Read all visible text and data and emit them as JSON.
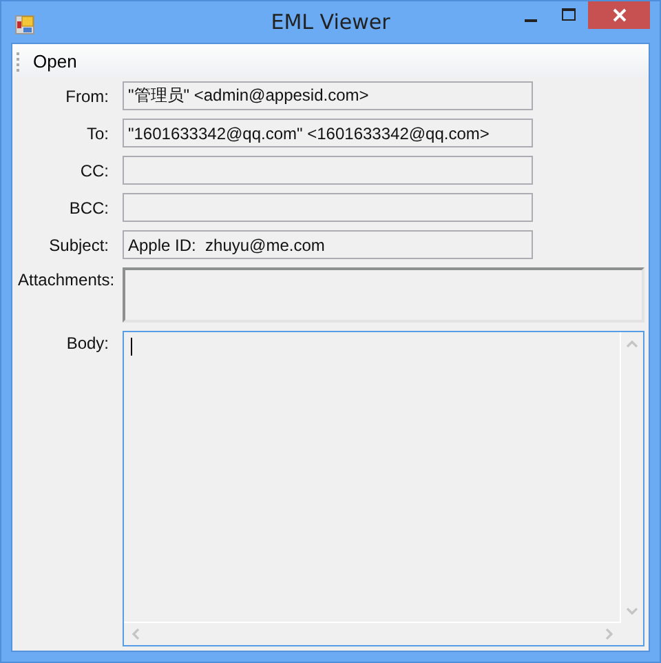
{
  "window": {
    "title": "EML Viewer"
  },
  "menu": [
    {
      "label": "Open"
    }
  ],
  "fields": [
    {
      "kind": "line",
      "label": "From:",
      "value": "\"管理员\" <admin@appesid.com>"
    },
    {
      "kind": "line",
      "label": "To:",
      "value": "\"1601633342@qq.com\" <1601633342@qq.com>"
    },
    {
      "kind": "line",
      "label": "CC:"
    },
    {
      "kind": "line",
      "label": "BCC:"
    },
    {
      "kind": "line",
      "label": "Subject:",
      "value": "Apple ID:  zhuyu@me.com"
    },
    {
      "kind": "list",
      "label": "Attachments:"
    },
    {
      "kind": "body",
      "label": "Body:",
      "focused": true
    }
  ]
}
